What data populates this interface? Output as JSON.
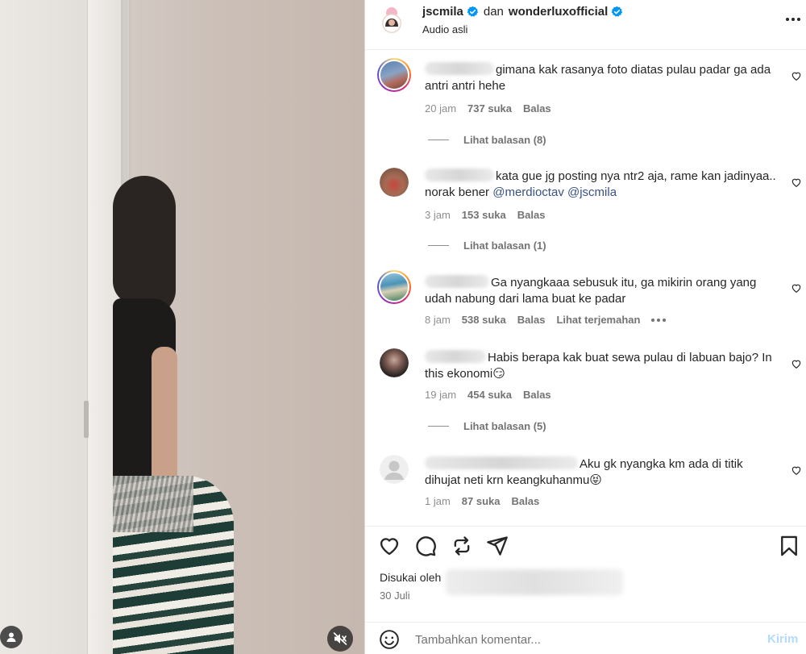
{
  "header": {
    "username": "jscmila",
    "joiner": "dan",
    "collaborator": "wonderluxofficial",
    "subtitle": "Audio asli"
  },
  "comments": [
    {
      "text": "gimana kak rasanya foto diatas pulau padar ga ada antri antri hehe",
      "time": "20 jam",
      "likes": "737 suka",
      "reply": "Balas",
      "view_replies": "Lihat balasan (8)"
    },
    {
      "text_a": "kata gue jg posting nya ntr2 aja, rame kan jadinyaa.. norak bener",
      "mention1": "@merdioctav",
      "mention2": "@jscmila",
      "time": "3 jam",
      "likes": "153 suka",
      "reply": "Balas",
      "view_replies": "Lihat balasan (1)"
    },
    {
      "text": "Ga nyangkaaa sebusuk itu, ga mikirin orang yang udah nabung dari lama buat ke padar",
      "time": "8 jam",
      "likes": "538 suka",
      "reply": "Balas",
      "translate": "Lihat terjemahan"
    },
    {
      "text": "Habis berapa kak buat sewa pulau di labuan bajo? In this ekonomi😏",
      "time": "19 jam",
      "likes": "454 suka",
      "reply": "Balas",
      "view_replies": "Lihat balasan (5)"
    },
    {
      "text": "Aku gk nyangka km ada di titik dihujat neti krn keangkuhanmu😝",
      "time": "1 jam",
      "likes": "87 suka",
      "reply": "Balas"
    }
  ],
  "footer": {
    "liked_by": "Disukai oleh",
    "date": "30 Juli",
    "comment_placeholder": "Tambahkan komentar...",
    "send_label": "Kirim"
  },
  "colors": {
    "verified_blue": "#0095f6",
    "mention": "#385185",
    "muted": "#737373",
    "send_disabled": "#b3dbff"
  },
  "icons": {
    "like": "heart-icon",
    "comment": "comment-icon",
    "repost": "repost-icon",
    "share": "send-icon",
    "save": "bookmark-icon",
    "emoji": "emoji-icon",
    "more": "more-icon",
    "mute": "muted-speaker-icon",
    "tagged": "user-icon"
  }
}
